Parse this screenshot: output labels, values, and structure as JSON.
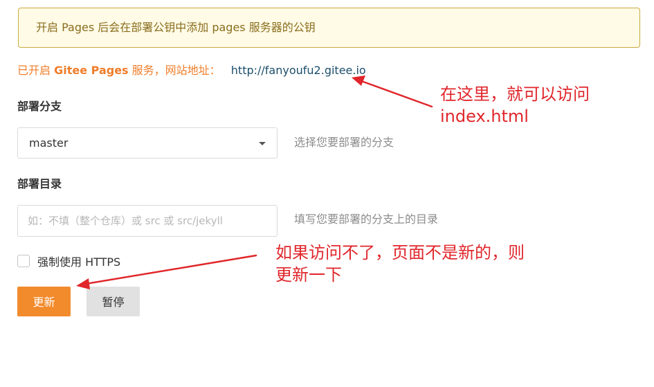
{
  "notice": {
    "text": "开启 Pages 后会在部署公钥中添加 pages 服务器的公钥"
  },
  "status": {
    "prefix": "已开启",
    "service_name": "Gitee Pages",
    "suffix": "服务，网站地址：",
    "url": "http://fanyoufu2.gitee.io"
  },
  "branch": {
    "label": "部署分支",
    "selected": "master",
    "hint": "选择您要部署的分支"
  },
  "directory": {
    "label": "部署目录",
    "placeholder": "如：不填（整个仓库）或 src 或 src/jekyll",
    "hint": "填写您要部署的分支上的目录"
  },
  "https": {
    "label": "强制使用 HTTPS",
    "checked": false
  },
  "buttons": {
    "update": "更新",
    "pause": "暂停"
  },
  "annotations": {
    "note_url_line1": "在这里，就可以访问",
    "note_url_line2": "index.html",
    "note_update_line1": "如果访问不了，页面不是新的，则",
    "note_update_line2": "更新一下",
    "color": "#e0262b"
  },
  "colors": {
    "accent": "#f28b2c",
    "notice_bg": "#fffbe6",
    "notice_border": "#c9a93e",
    "link": "#1c4e6b"
  }
}
